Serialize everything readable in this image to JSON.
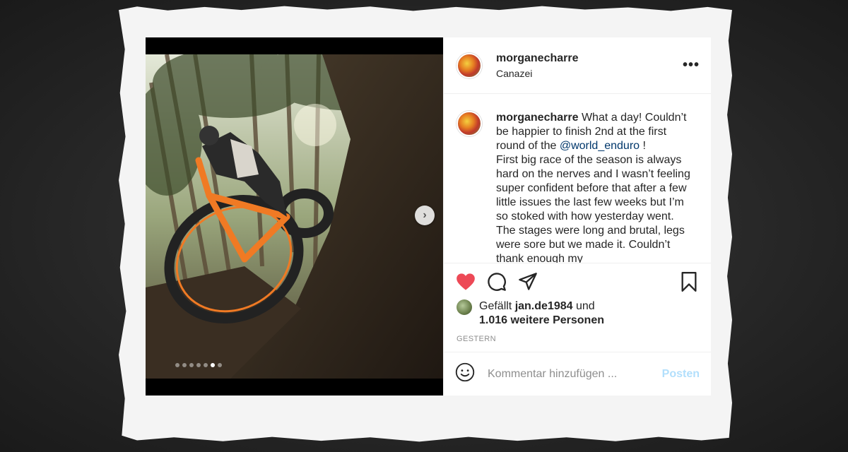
{
  "post": {
    "header": {
      "username": "morganecharre",
      "location": "Canazei",
      "more_icon": "more-options-icon",
      "more_label": "•••"
    },
    "media": {
      "next_icon": "chevron-right-icon",
      "next_label": "›",
      "carousel_total": 7,
      "carousel_active": 6
    },
    "caption": {
      "username": "morganecharre",
      "text_before": " What a day! Couldn’t be happier to finish 2nd at the first round of the ",
      "mention": "@world_enduro",
      "text_after": " !",
      "text_rest": "First big race of the season is always hard on the nerves and I wasn’t feeling super confident before that after a few little issues the last few weeks but I’m so stoked with how yesterday went. The stages were long and brutal, legs were sore but we made it. Couldn’t thank enough my"
    },
    "actions": {
      "like_icon": "heart-filled-icon",
      "comment_icon": "comment-icon",
      "share_icon": "share-icon",
      "save_icon": "bookmark-icon",
      "like_color": "#ed4956"
    },
    "likes": {
      "prefix": "Gefällt ",
      "user": "jan.de1984",
      "middle": " und",
      "others": "1.016 weitere Personen"
    },
    "timestamp": "GESTERN",
    "comment_box": {
      "emoji_icon": "smiley-icon",
      "placeholder": "Kommentar hinzufügen ...",
      "post_label": "Posten"
    }
  }
}
